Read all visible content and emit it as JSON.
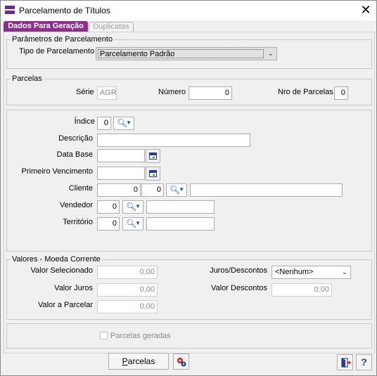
{
  "window": {
    "title": "Parcelamento de Títulos",
    "close_symbol": "✕"
  },
  "tabs": [
    {
      "label": "Dados Para Geração",
      "active": true
    },
    {
      "label": "Duplicatas",
      "active": false
    }
  ],
  "params": {
    "group_label": "Parâmetros de Parcelamento",
    "tipo_label": "Tipo de Parcelamento",
    "tipo_value": "Parcelamento Padrão"
  },
  "parcelas": {
    "group_label": "Parcelas",
    "serie_label": "Série",
    "serie_value": "AGR",
    "numero_label": "Número",
    "numero_value": "0",
    "nro_label": "Nro de Parcelas",
    "nro_value": "0"
  },
  "details": {
    "indice_label": "Índice",
    "indice_value": "0",
    "descricao_label": "Descrição",
    "descricao_value": "",
    "data_base_label": "Data Base",
    "data_base_value": "",
    "primeiro_venc_label": "Primeiro Vencimento",
    "primeiro_venc_value": "",
    "cliente_label": "Cliente",
    "cliente_code1": "0",
    "cliente_code2": "0",
    "cliente_name": "",
    "vendedor_label": "Vendedor",
    "vendedor_value": "0",
    "vendedor_name": "",
    "territorio_label": "Território",
    "territorio_value": "0",
    "territorio_name": ""
  },
  "valores": {
    "group_label": "Valores - Moeda Corrente",
    "valor_selecionado_label": "Valor Selecionado",
    "valor_selecionado_value": "0,00",
    "valor_juros_label": "Valor Juros",
    "valor_juros_value": "0,00",
    "valor_parcelar_label": "Valor a Parcelar",
    "valor_parcelar_value": "0,00",
    "juros_descontos_label": "Juros/Descontos",
    "juros_descontos_value": "<Nenhum>",
    "valor_descontos_label": "Valor Descontos",
    "valor_descontos_value": "0,00"
  },
  "status": {
    "parcelas_geradas_label": "Parcelas geradas",
    "parcelas_geradas_checked": false
  },
  "footer": {
    "parcelas_button_underline": "P",
    "parcelas_button_rest": "arcelas",
    "help_symbol": "?"
  },
  "icons": {
    "search": "search-icon",
    "dropdown": "chevron-down-icon",
    "calendar": "calendar-icon",
    "gears": "gears-icon",
    "exit": "exit-door-icon",
    "help": "help-icon"
  },
  "colors": {
    "tab_active": "#8b2f8b",
    "icon_blue": "#1a4fb5"
  }
}
